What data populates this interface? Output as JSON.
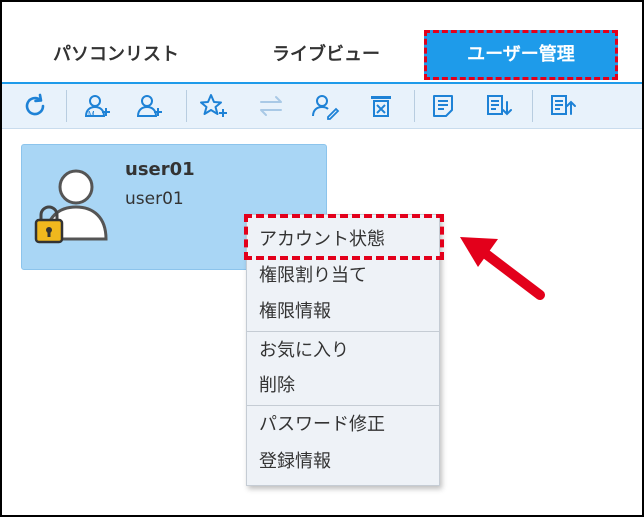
{
  "tabs": [
    {
      "label": "パソコンリスト"
    },
    {
      "label": "ライブビュー"
    },
    {
      "label": "ユーザー管理"
    }
  ],
  "toolbar": {
    "icons": [
      "refresh-icon",
      "add-pc-user-icon",
      "add-user-icon",
      "add-favorite-icon",
      "sync-icon",
      "edit-user-icon",
      "delete-icon",
      "list-icon",
      "import-icon",
      "export-icon"
    ]
  },
  "user_card": {
    "name": "user01",
    "sub": "user01"
  },
  "context_menu": {
    "items": [
      {
        "label": "アカウント状態"
      },
      {
        "label": "権限割り当て"
      },
      {
        "label": "権限情報"
      },
      {
        "label": "お気に入り"
      },
      {
        "label": "削除"
      },
      {
        "label": "パスワード修正"
      },
      {
        "label": "登録情報"
      }
    ]
  },
  "colors": {
    "accent": "#1e9bea",
    "highlight": "#e3001b",
    "card": "#a9d6f5"
  }
}
